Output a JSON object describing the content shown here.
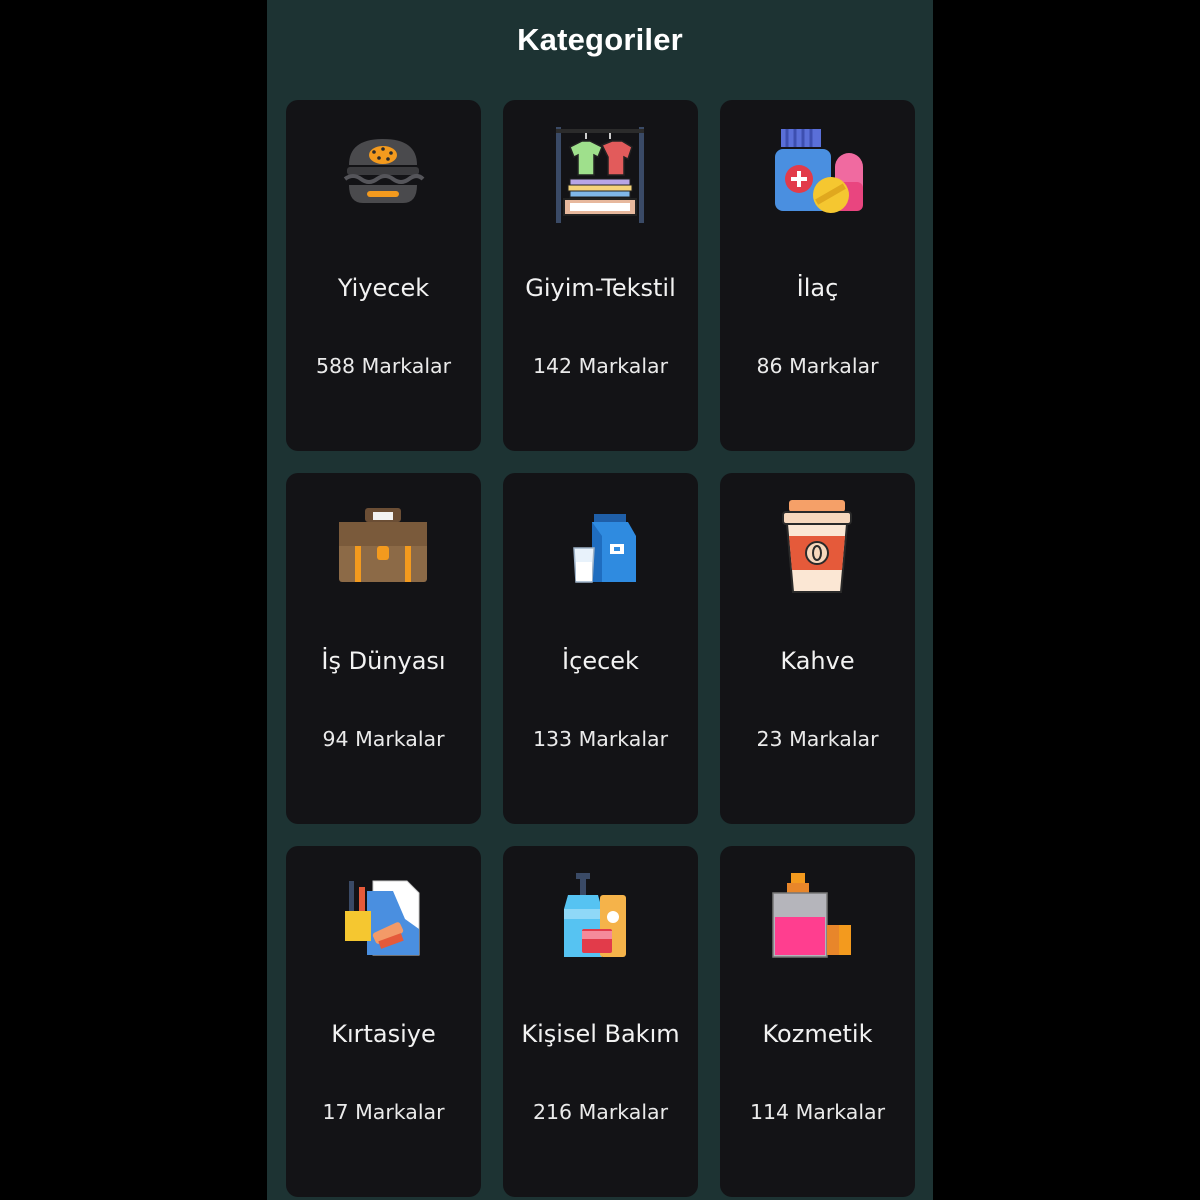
{
  "header": {
    "title": "Kategoriler"
  },
  "categories": [
    {
      "name": "Yiyecek",
      "count": "588 Markalar",
      "icon": "burger-icon"
    },
    {
      "name": "Giyim-Tekstil",
      "count": "142 Markalar",
      "icon": "clothes-rack-icon"
    },
    {
      "name": "İlaç",
      "count": "86 Markalar",
      "icon": "medicine-icon"
    },
    {
      "name": "İş Dünyası",
      "count": "94 Markalar",
      "icon": "briefcase-icon"
    },
    {
      "name": "İçecek",
      "count": "133 Markalar",
      "icon": "milk-carton-icon"
    },
    {
      "name": "Kahve",
      "count": "23 Markalar",
      "icon": "coffee-cup-icon"
    },
    {
      "name": "Kırtasiye",
      "count": "17 Markalar",
      "icon": "stationery-icon"
    },
    {
      "name": "Kişisel Bakım",
      "count": "216 Markalar",
      "icon": "personal-care-icon"
    },
    {
      "name": "Kozmetik",
      "count": "114 Markalar",
      "icon": "perfume-icon"
    }
  ],
  "colors": {
    "background": "#1d3333",
    "card": "#131316",
    "text": "#f2f2f2"
  }
}
